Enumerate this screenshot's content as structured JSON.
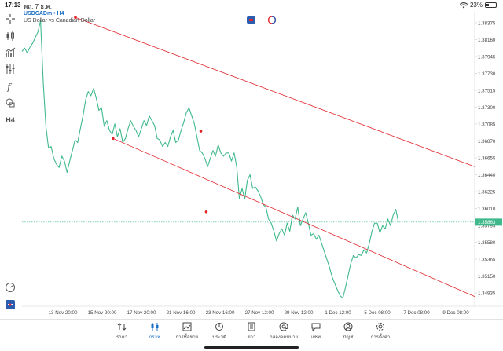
{
  "status": {
    "time": "17:13",
    "date": "พฤ. 7 ธ.ค.",
    "battery": "23%",
    "battery_level": 0.23
  },
  "symbol": {
    "ticker": "USDCADm • H4",
    "description": "US Dollar vs Canadian Dollar"
  },
  "chart_data": {
    "type": "line",
    "title": "",
    "x_labels": [
      "13 Nov 20:00",
      "15 Nov 20:00",
      "17 Nov 20:00",
      "21 Nov 16:00",
      "23 Nov 16:00",
      "27 Nov 12:00",
      "29 Nov 12:00",
      "1 Dec 12:00",
      "5 Dec 08:00",
      "7 Dec 08:00",
      "9 Dec 08:00"
    ],
    "y_ticks": [
      "1.38375",
      "1.38160",
      "1.37945",
      "1.37730",
      "1.37515",
      "1.37300",
      "1.37085",
      "1.36870",
      "1.36655",
      "1.36440",
      "1.36225",
      "1.36010",
      "1.35795",
      "1.35580",
      "1.35365",
      "1.35150",
      "1.34935"
    ],
    "current_price": "1.35863",
    "ylim": [
      1.3482,
      1.3848
    ],
    "series": [
      {
        "values": [
          1.3798,
          1.3802,
          1.3796,
          1.3803,
          1.3808,
          1.3815,
          1.3822,
          1.3836,
          1.376,
          1.3705,
          1.3678,
          1.368,
          1.3665,
          1.3658,
          1.3654,
          1.3668,
          1.3662,
          1.3648,
          1.3662,
          1.3675,
          1.3688,
          1.3685,
          1.3702,
          1.3718,
          1.3738,
          1.3748,
          1.3743,
          1.3752,
          1.374,
          1.3725,
          1.3728,
          1.3705,
          1.3712,
          1.37,
          1.3695,
          1.3708,
          1.3692,
          1.3702,
          1.3685,
          1.369,
          1.3702,
          1.3712,
          1.3705,
          1.37,
          1.3692,
          1.3702,
          1.3712,
          1.3706,
          1.3718,
          1.3712,
          1.3706,
          1.369,
          1.3688,
          1.368,
          1.3685,
          1.368,
          1.3692,
          1.37,
          1.3685,
          1.3688,
          1.37,
          1.371,
          1.3722,
          1.3728,
          1.3718,
          1.3708,
          1.3692,
          1.3675,
          1.3672,
          1.3665,
          1.3655,
          1.3665,
          1.3675,
          1.3668,
          1.3682,
          1.3672,
          1.3668,
          1.3672,
          1.3672,
          1.3662,
          1.3672,
          1.3655,
          1.3615,
          1.3628,
          1.3615,
          1.3638,
          1.3645,
          1.3628,
          1.363,
          1.3625,
          1.3618,
          1.3608,
          1.3605,
          1.359,
          1.3585,
          1.3575,
          1.3563,
          1.3572,
          1.3578,
          1.357,
          1.3585,
          1.3575,
          1.3595,
          1.359,
          1.3605,
          1.3582,
          1.359,
          1.3598,
          1.3585,
          1.357,
          1.3572,
          1.3565,
          1.357,
          1.356,
          1.355,
          1.354,
          1.353,
          1.3518,
          1.351,
          1.3502,
          1.3495,
          1.3492,
          1.3505,
          1.352,
          1.3535,
          1.3545,
          1.3542,
          1.3546,
          1.3545,
          1.3552,
          1.3548,
          1.356,
          1.3575,
          1.3585,
          1.3585,
          1.3573,
          1.3582,
          1.3578,
          1.359,
          1.3582,
          1.3595,
          1.3602,
          1.3586
        ]
      }
    ],
    "trend_lines": [
      {
        "color": "#e0262b",
        "points": [
          [
            0.118,
            1.384
          ],
          [
            0.395,
            1.3699
          ],
          [
            1.0,
            1.3655
          ]
        ]
      },
      {
        "color": "#e0262b",
        "points": [
          [
            0.201,
            1.369
          ],
          [
            0.407,
            1.3599
          ],
          [
            1.0,
            1.3494
          ]
        ]
      }
    ],
    "line_color": "#3fb98b",
    "grid": false
  },
  "nav": {
    "items": [
      {
        "label": "ราคา",
        "icon": "arrows-updown-icon",
        "active": false
      },
      {
        "label": "กราฟ",
        "icon": "candles-icon",
        "active": true
      },
      {
        "label": "การซื้อขาย",
        "icon": "trend-chart-icon",
        "active": false
      },
      {
        "label": "ประวัติ",
        "icon": "history-icon",
        "active": false
      },
      {
        "label": "ข่าว",
        "icon": "news-icon",
        "active": false
      },
      {
        "label": "กล่องจดหมาย",
        "icon": "mailbox-icon",
        "active": false
      },
      {
        "label": "แชท",
        "icon": "chat-icon",
        "active": false
      },
      {
        "label": "บัญชี",
        "icon": "account-icon",
        "active": false
      },
      {
        "label": "การตั้งค่า",
        "icon": "settings-icon",
        "active": false
      }
    ]
  },
  "colors": {
    "accent": "#1a6fc9",
    "trend": "#e0262b",
    "price_line": "#3fb98b",
    "price_label_bg": "#3fb98b"
  }
}
